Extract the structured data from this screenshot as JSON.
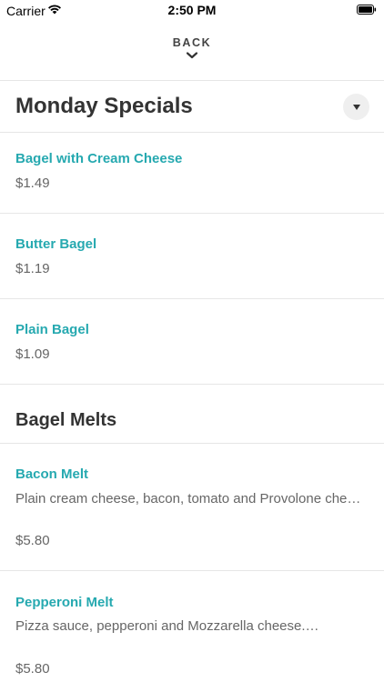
{
  "status_bar": {
    "carrier": "Carrier",
    "time": "2:50 PM"
  },
  "header": {
    "back_label": "BACK"
  },
  "accent_color": "#26a9b0",
  "sections": [
    {
      "title": "Monday Specials",
      "items": [
        {
          "name": "Bagel with Cream Cheese",
          "price": "$1.49"
        },
        {
          "name": "Butter Bagel",
          "price": "$1.19"
        },
        {
          "name": "Plain Bagel",
          "price": "$1.09"
        }
      ]
    },
    {
      "title": "Bagel Melts",
      "items": [
        {
          "name": "Bacon Melt",
          "description": "Plain cream cheese, bacon, tomato and Provolone chee…",
          "price": "$5.80"
        },
        {
          "name": "Pepperoni Melt",
          "description": "Pizza sauce, pepperoni and Mozzarella cheese.…",
          "price": "$5.80"
        }
      ]
    }
  ]
}
